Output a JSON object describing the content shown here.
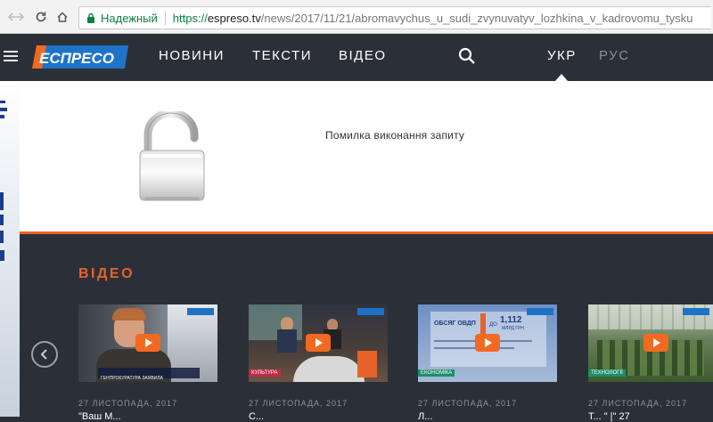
{
  "browser": {
    "secure_label": "Надежный",
    "url_scheme": "https://",
    "url_domain": "espreso.tv",
    "url_path": "/news/2017/11/21/abromavychus_u_sudi_zvynuvatyv_lozhkina_v_kadrovomu_tysku"
  },
  "header": {
    "logo_text": "ЕСПРЕСО",
    "nav": [
      "НОВИНИ",
      "ТЕКСТИ",
      "ВІДЕО"
    ],
    "lang_active": "УКР",
    "lang_other": "РУС"
  },
  "error": {
    "message": "Помилка виконання запиту"
  },
  "video_section": {
    "title": "ВІДЕО",
    "cards": [
      {
        "date": "27 ЛИСТОПАДА, 2017",
        "title": "\"Ваш М..."
      },
      {
        "date": "27 ЛИСТОПАДА, 2017",
        "title": "С..."
      },
      {
        "date": "27 ЛИСТОПАДА, 2017",
        "title": "Л..."
      },
      {
        "date": "27 ЛИСТОПАДА, 2017",
        "title": "Т... \" |\" 27"
      }
    ],
    "thumb_texts": {
      "t1": "ГЕНПРОКУРАТУРА ЗАЯВИЛА",
      "t3_a": "ОБСЯГ ОВДП",
      "t3_b": "ДО",
      "t3_c": "1,112",
      "t3_d": "МЛРД ГРН",
      "t3_tag": "ЕКОНОМІКА",
      "t2_tag": "КУЛЬТУРА",
      "t4_tag": "ТЕХНОЛОГІЇ"
    }
  },
  "colors": {
    "accent": "#e8622c",
    "header_bg": "#2b3038",
    "secure_green": "#0b8043"
  }
}
